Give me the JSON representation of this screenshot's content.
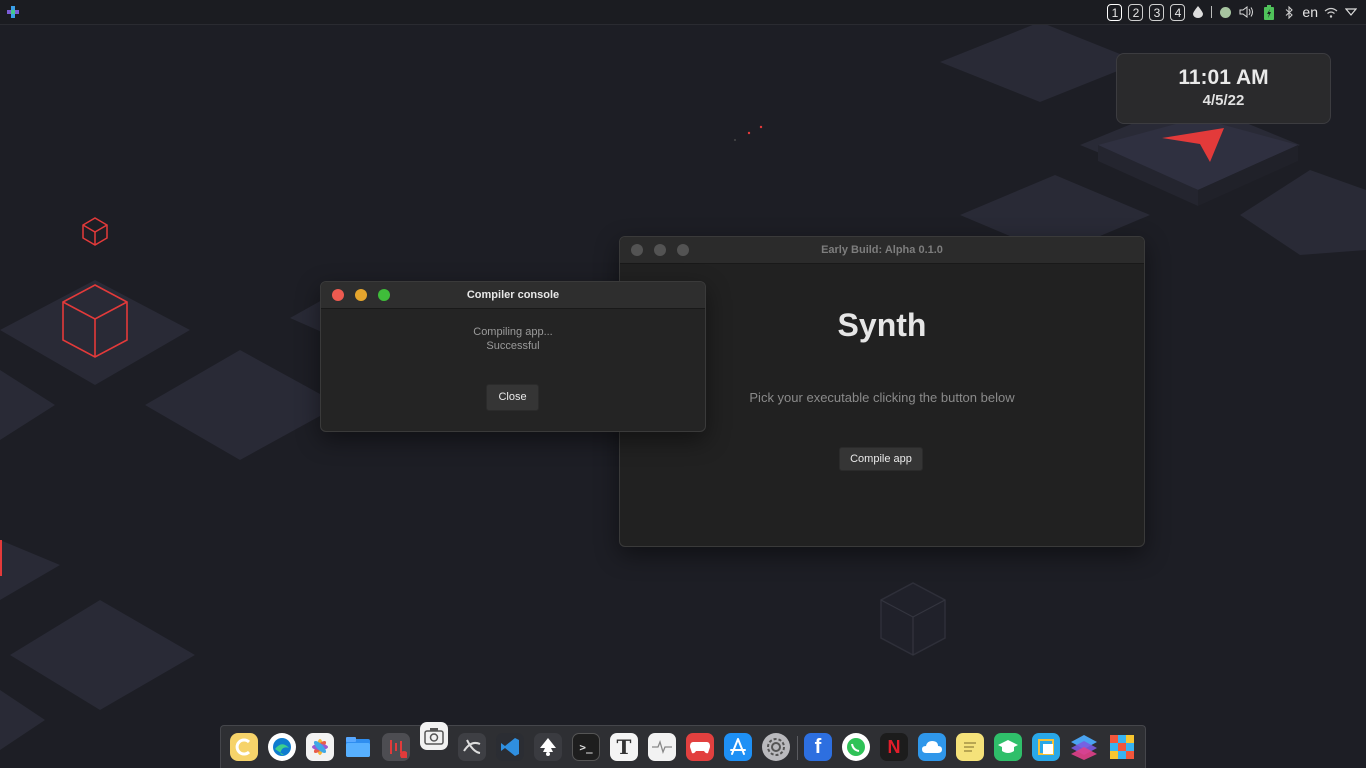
{
  "topbar": {
    "workspaces": [
      "1",
      "2",
      "3",
      "4"
    ],
    "language": "en",
    "tray_icons": [
      "drop-icon",
      "status-circle-icon",
      "volume-icon",
      "battery-icon",
      "bluetooth-icon",
      "wifi-icon",
      "chevron-down-icon"
    ]
  },
  "clock": {
    "time": "11:01 AM",
    "date": "4/5/22"
  },
  "synth_window": {
    "title": "Early Build: Alpha 0.1.0",
    "heading": "Synth",
    "subtitle": "Pick your executable clicking the button below",
    "compile_label": "Compile app"
  },
  "console_window": {
    "title": "Compiler console",
    "line1": "Compiling app...",
    "line2": "Successful",
    "close_label": "Close"
  },
  "dock": {
    "apps": [
      "launchpad-icon",
      "edge-browser-icon",
      "photos-icon",
      "files-icon",
      "audio-recorder-icon",
      "screenshot-icon",
      "obs-icon",
      "vscode-icon",
      "inkscape-icon",
      "terminal-icon",
      "typora-icon",
      "system-monitor-icon",
      "games-icon",
      "app-store-icon",
      "settings-icon",
      "facebook-icon",
      "whatsapp-icon",
      "netflix-icon",
      "icloud-icon",
      "notes-icon",
      "education-icon",
      "window-tool-icon",
      "layers-icon",
      "grid-app-icon"
    ]
  },
  "colors": {
    "accent_red": "#e33a3a",
    "traffic_red": "#ff5f57",
    "traffic_yellow": "#febc2e",
    "traffic_green": "#28c840"
  }
}
